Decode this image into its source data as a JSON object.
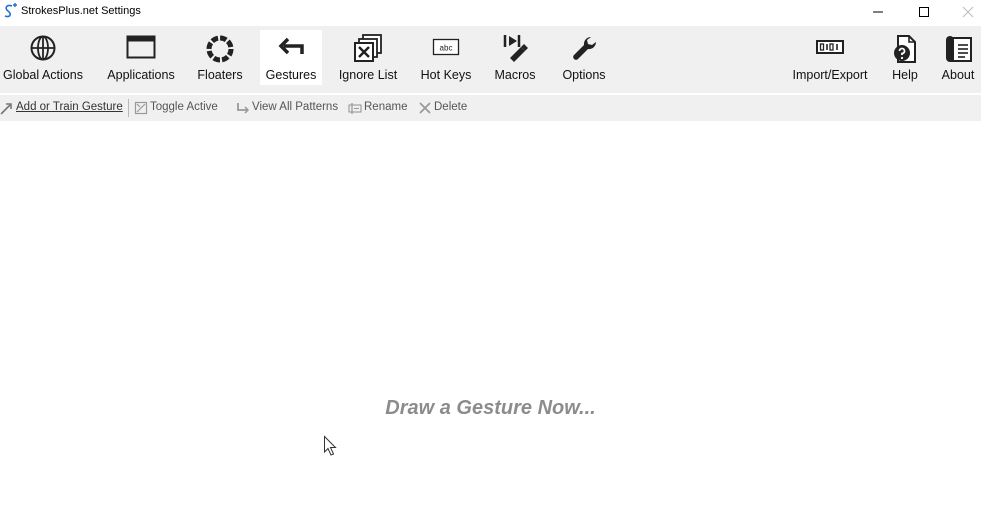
{
  "window": {
    "title": "StrokesPlus.net Settings",
    "controls": [
      "minimize",
      "maximize",
      "close"
    ]
  },
  "ribbon": {
    "active": "Gestures",
    "left_items": [
      {
        "label": "Global Actions",
        "icon": "globe-icon"
      },
      {
        "label": "Applications",
        "icon": "window-icon"
      },
      {
        "label": "Floaters",
        "icon": "ring-icon"
      },
      {
        "label": "Gestures",
        "icon": "gesture-arrow-icon"
      },
      {
        "label": "Ignore List",
        "icon": "ignore-list-icon"
      },
      {
        "label": "Hot Keys",
        "icon": "keyboard-key-icon"
      },
      {
        "label": "Macros",
        "icon": "macro-icon"
      },
      {
        "label": "Options",
        "icon": "wrench-icon"
      }
    ],
    "right_items": [
      {
        "label": "Import/Export",
        "icon": "binary-icon"
      },
      {
        "label": "Help",
        "icon": "help-icon"
      },
      {
        "label": "About",
        "icon": "about-icon"
      }
    ]
  },
  "toolbar": {
    "items": [
      {
        "label": "Add or Train Gesture",
        "icon": "add-gesture-icon",
        "enabled": true
      },
      {
        "label": "Toggle Active",
        "icon": "toggle-icon",
        "enabled": false
      },
      {
        "label": "View All Patterns",
        "icon": "patterns-icon",
        "enabled": false
      },
      {
        "label": "Rename",
        "icon": "rename-icon",
        "enabled": false
      },
      {
        "label": "Delete",
        "icon": "delete-icon",
        "enabled": false
      }
    ]
  },
  "main": {
    "prompt": "Draw a Gesture Now..."
  },
  "colors": {
    "ribbon_bg": "#f0f0f0",
    "active_tab_bg": "#ffffff",
    "prompt_text": "#8c8c8c",
    "disabled_text": "#555555"
  }
}
